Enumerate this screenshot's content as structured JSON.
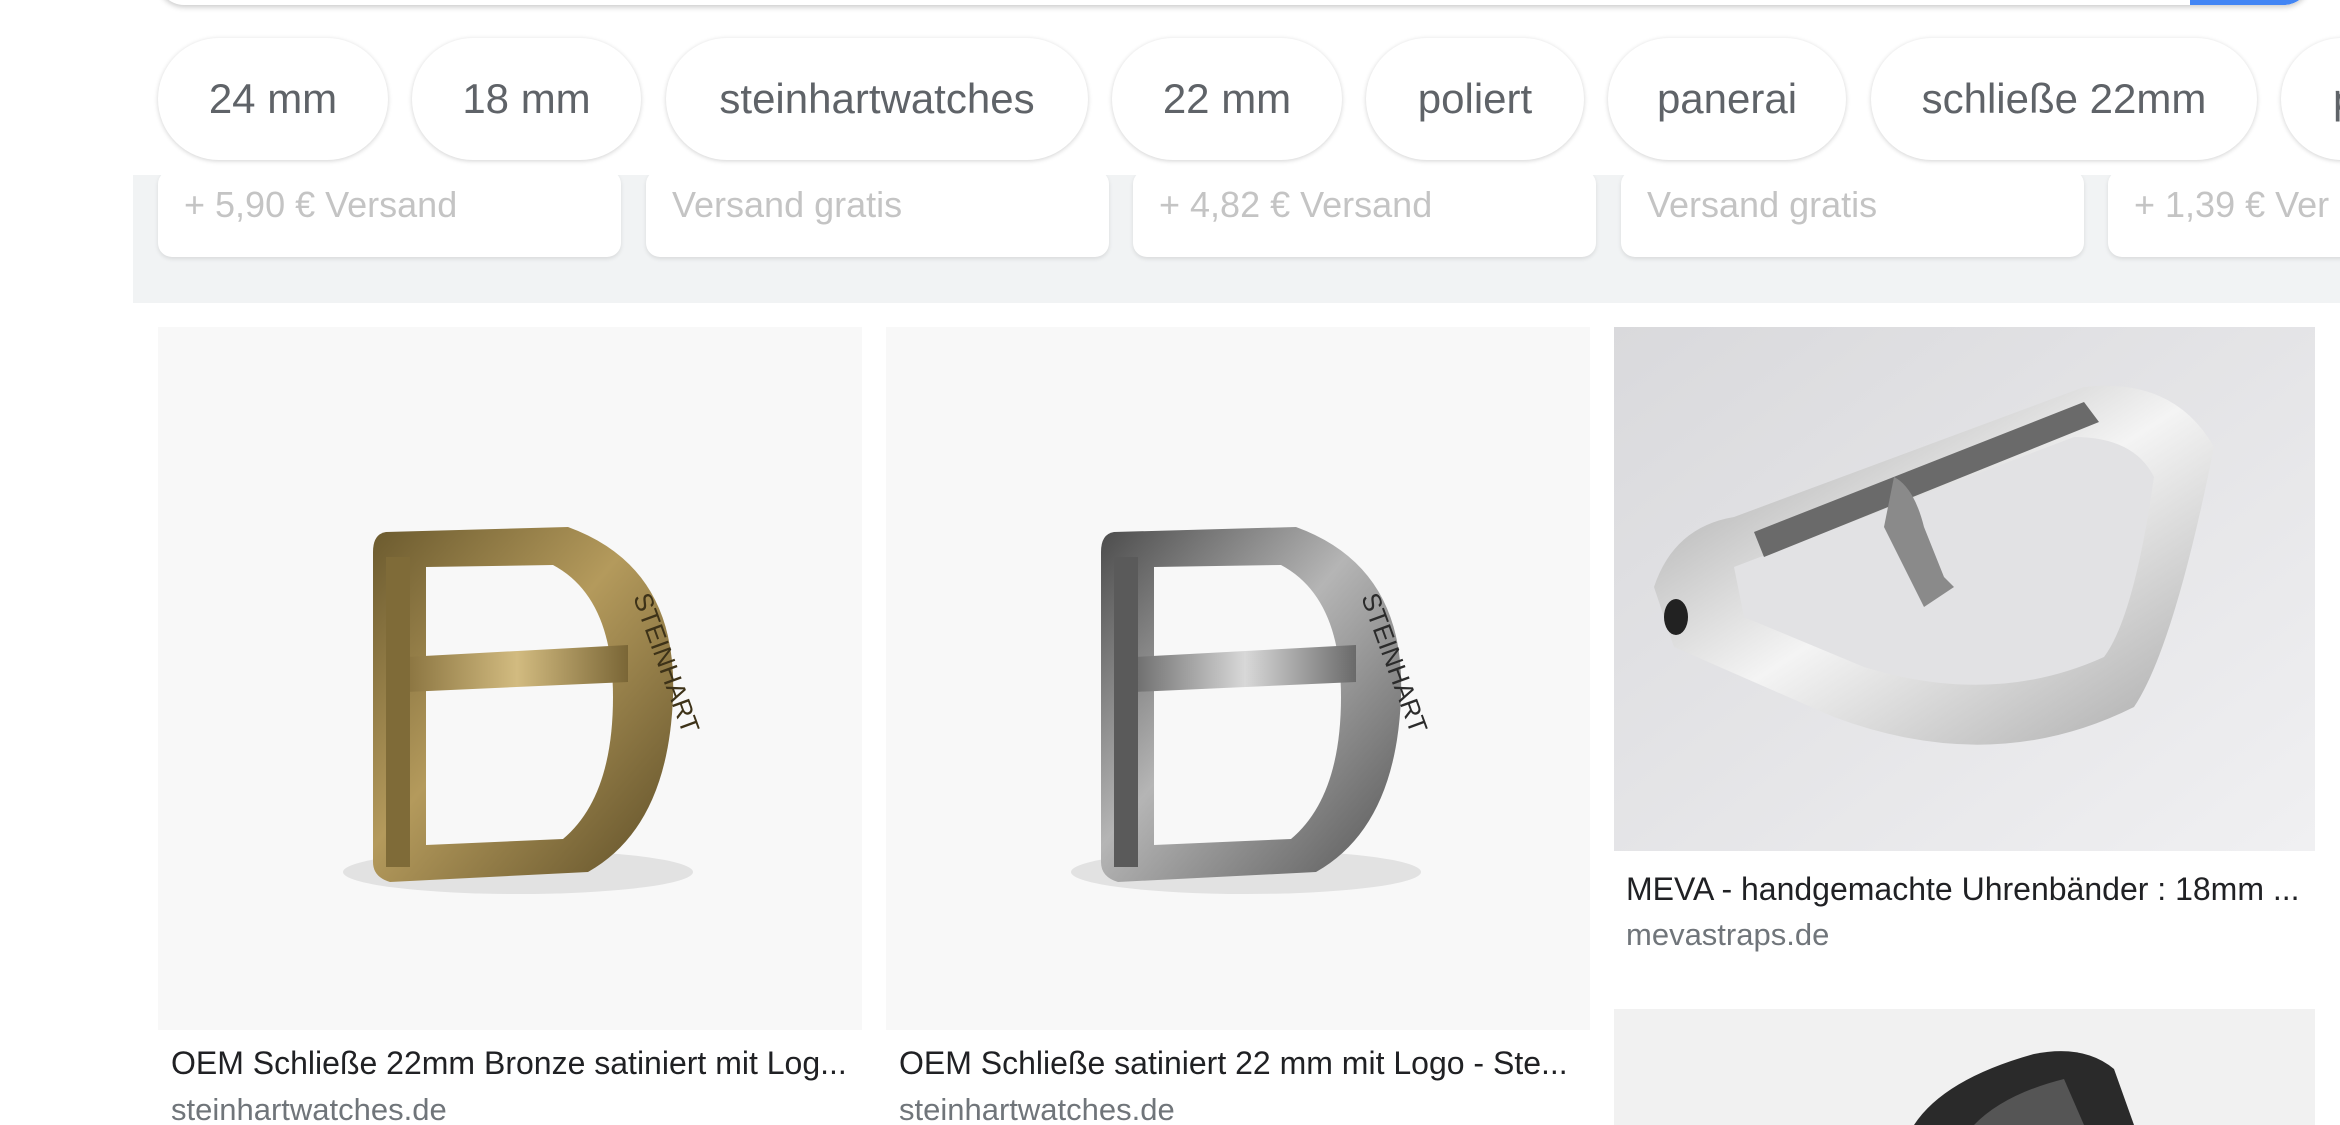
{
  "chips": [
    {
      "label": "24 mm"
    },
    {
      "label": "18 mm"
    },
    {
      "label": "steinhartwatches"
    },
    {
      "label": "22 mm"
    },
    {
      "label": "poliert"
    },
    {
      "label": "panerai"
    },
    {
      "label": "schließe 22mm"
    },
    {
      "label": "p"
    }
  ],
  "shopping_cards": [
    {
      "shipping": "+ 5,90 € Versand"
    },
    {
      "shipping": "Versand gratis"
    },
    {
      "shipping": "+ 4,82 € Versand"
    },
    {
      "shipping": "Versand gratis"
    },
    {
      "shipping": "+ 1,39 € Ver"
    }
  ],
  "results": [
    {
      "title": "OEM Schließe 22mm Bronze satiniert mit Log...",
      "source": "steinhartwatches.de",
      "image_icon": "bronze-buckle-image",
      "engraving": "STEINHART"
    },
    {
      "title": "OEM Schließe satiniert 22 mm mit Logo - Ste...",
      "source": "steinhartwatches.de",
      "image_icon": "steel-buckle-image",
      "engraving": "STEINHART"
    },
    {
      "title": "MEVA - handgemachte Uhrenbänder : 18mm ...",
      "source": "mevastraps.de",
      "image_icon": "polished-buckle-image"
    },
    {
      "image_icon": "dark-buckle-image"
    }
  ],
  "colors": {
    "accent": "#4285f4",
    "chip_text": "#5f6368",
    "source_text": "#70757a",
    "band": "#f1f3f4"
  }
}
